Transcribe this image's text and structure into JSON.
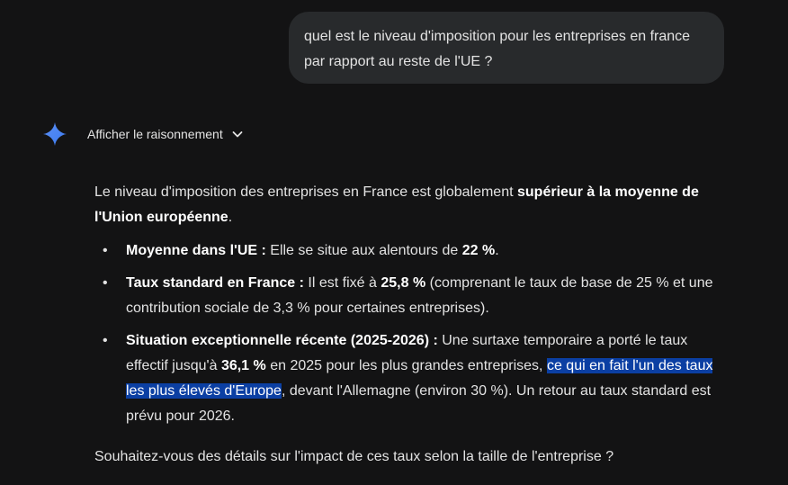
{
  "user_message": {
    "line1": "quel est le niveau d'imposition pour les entreprises en france",
    "line2": "par rapport au reste de l'UE ?"
  },
  "assistant": {
    "icon": "gemini-sparkle-icon",
    "reasoning_toggle_label": "Afficher le raisonnement",
    "intro": {
      "text": "Le niveau d'imposition des entreprises en France est globalement ",
      "bold": "supérieur à la moyenne de l'Union européenne",
      "end": "."
    },
    "bullets": [
      {
        "bold": "Moyenne dans l'UE :",
        "text": " Elle se situe aux alentours de ",
        "bold2": "22 %",
        "end": "."
      },
      {
        "bold": "Taux standard en France :",
        "text": " Il est fixé à ",
        "bold2": "25,8 %",
        "end": " (comprenant le taux de base de 25 % et une contribution sociale de 3,3 % pour certaines entreprises)."
      },
      {
        "bold": "Situation exceptionnelle récente (2025-2026) :",
        "text": " Une surtaxe temporaire a porté le taux effectif jusqu'à ",
        "bold2": "36,1 %",
        "mid": " en 2025 pour les plus grandes entreprises, ",
        "highlight": "ce qui en fait l'un des taux les plus élevés d'Europe",
        "end": ", devant l'Allemagne (environ 30 %). Un retour au taux standard est prévu pour 2026."
      }
    ],
    "closing": "Souhaitez-vous des détails sur l'impact de ces taux selon la taille de l'entreprise ?"
  },
  "colors": {
    "background": "#131314",
    "user_bubble": "#282a2c",
    "highlight": "#0b3fa3",
    "sparkle": "#4a8af4"
  }
}
